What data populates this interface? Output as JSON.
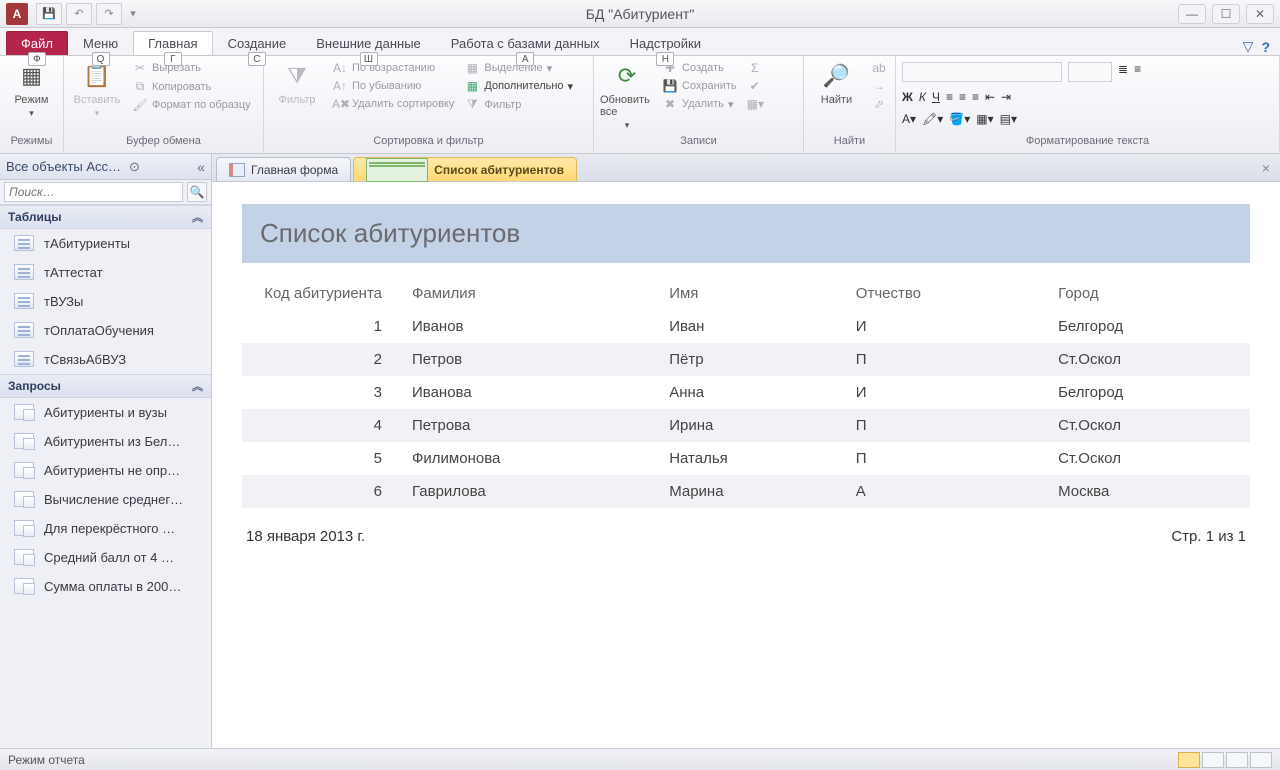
{
  "title": "БД \"Абитуриент\"",
  "qat_app": "A",
  "tabs": {
    "file": "Файл",
    "menu": "Меню",
    "home": "Главная",
    "create": "Создание",
    "extdata": "Внешние данные",
    "dbtools": "Работа с базами данных",
    "addins": "Надстройки",
    "keys": {
      "file": "Ф",
      "menu": "Q",
      "home": "Г",
      "create": "С",
      "extdata": "Ш",
      "dbtools": "А",
      "addins": "Н"
    }
  },
  "ribbon": {
    "modes": {
      "big": "Режим",
      "label": "Режимы"
    },
    "clipboard": {
      "paste": "Вставить",
      "cut": "Вырезать",
      "copy": "Копировать",
      "painter": "Формат по образцу",
      "label": "Буфер обмена"
    },
    "sortfilter": {
      "filter": "Фильтр",
      "asc": "По возрастанию",
      "desc": "По убыванию",
      "clear": "Удалить сортировку",
      "selection": "Выделение",
      "advanced": "Дополнительно",
      "toggle": "Фильтр",
      "label": "Сортировка и фильтр"
    },
    "records": {
      "refresh": "Обновить все",
      "new": "Создать",
      "save": "Сохранить",
      "delete": "Удалить",
      "label": "Записи"
    },
    "find": {
      "find": "Найти",
      "label": "Найти"
    },
    "textfmt": {
      "label": "Форматирование текста"
    }
  },
  "nav": {
    "header": "Все объекты Acc…",
    "search_placeholder": "Поиск…",
    "groups": [
      {
        "title": "Таблицы",
        "type": "table",
        "items": [
          "тАбитуриенты",
          "тАттестат",
          "тВУЗы",
          "тОплатаОбучения",
          "тСвязьАбВУЗ"
        ]
      },
      {
        "title": "Запросы",
        "type": "query",
        "items": [
          "Абитуриенты и вузы",
          "Абитуриенты из Бел…",
          "Абитуриенты не опр…",
          "Вычисление среднег…",
          "Для перекрёстного …",
          "Средний балл от 4 …",
          "Сумма оплаты в 200…"
        ]
      }
    ]
  },
  "doctabs": [
    {
      "label": "Главная форма",
      "icon": "form",
      "active": false
    },
    {
      "label": "Список абитуриентов",
      "icon": "report",
      "active": true
    }
  ],
  "report": {
    "title": "Список абитуриентов",
    "columns": [
      "Код абитуриента",
      "Фамилия",
      "Имя",
      "Отчество",
      "Город"
    ],
    "rows": [
      {
        "code": "1",
        "fam": "Иванов",
        "name": "Иван",
        "patr": "И",
        "city": "Белгород"
      },
      {
        "code": "2",
        "fam": "Петров",
        "name": "Пётр",
        "patr": "П",
        "city": "Ст.Оскол"
      },
      {
        "code": "3",
        "fam": "Иванова",
        "name": "Анна",
        "patr": "И",
        "city": "Белгород"
      },
      {
        "code": "4",
        "fam": "Петрова",
        "name": "Ирина",
        "patr": "П",
        "city": "Ст.Оскол"
      },
      {
        "code": "5",
        "fam": "Филимонова",
        "name": "Наталья",
        "patr": "П",
        "city": "Ст.Оскол"
      },
      {
        "code": "6",
        "fam": "Гаврилова",
        "name": "Марина",
        "patr": "А",
        "city": "Москва"
      }
    ],
    "date": "18 января 2013 г.",
    "page": "Стр. 1 из 1"
  },
  "statusbar": "Режим отчета"
}
